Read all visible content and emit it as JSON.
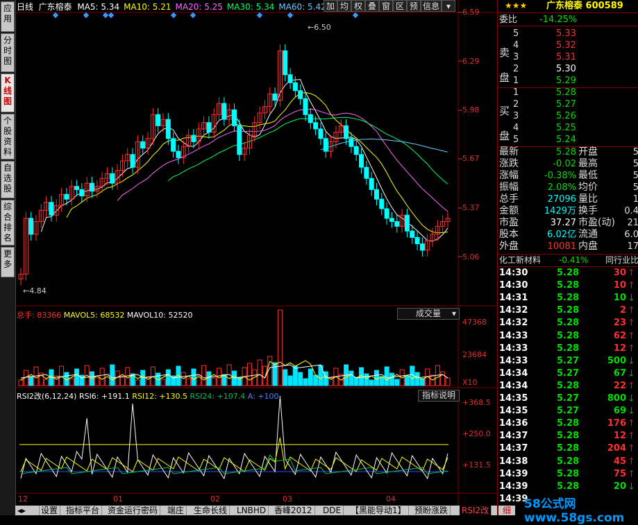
{
  "left_tabs": [
    "应用",
    "分时图",
    "K线图",
    "个股资料",
    "自选股",
    "综合排名",
    "更多"
  ],
  "header": {
    "period": "日线",
    "name": "广东榕泰",
    "ma": [
      {
        "label": "MA5: 5.34",
        "color": "#ffffff"
      },
      {
        "label": "MA10: 5.21",
        "color": "#ffff00"
      },
      {
        "label": "MA20: 5.25",
        "color": "#ff66ff"
      },
      {
        "label": "MA30: 5.34",
        "color": "#00ff66"
      },
      {
        "label": "MA60: 5.42",
        "color": "#66ccff"
      }
    ],
    "buttons": [
      "加",
      "均",
      "权",
      "叠",
      "窗",
      "区",
      "预",
      "信息",
      "▾"
    ]
  },
  "price_axis": [
    "6.59",
    "6.29",
    "5.98",
    "5.67",
    "5.37",
    "5.06"
  ],
  "annotations": {
    "high": "6.50",
    "low": "4.84"
  },
  "volume": {
    "title": "总手: 83366",
    "mavol5": "MAVOL5: 68532",
    "mavol10": "MAVOL10: 52520",
    "dropdown": "成交量",
    "axis": [
      "47368",
      "23684",
      "X10"
    ]
  },
  "rsi": {
    "title": "RSI2改(6,12,24)",
    "rsi6": "RSI6: +191.1",
    "rsi12": "RSI12: +130.5",
    "rsi24": "RSI24: +107.4",
    "a": "A: +100.",
    "explain": "指标说明",
    "axis": [
      "+368.5",
      "+250.0",
      "+131.5"
    ]
  },
  "x_axis": [
    "12",
    "01",
    "02",
    "03",
    "04"
  ],
  "bottom_tabs": [
    "设置",
    "指标平台",
    "资金运行密码",
    "端庄",
    "生命长线",
    "LNBHD",
    "香峰2012",
    "DDE",
    "【黑能导动1】",
    "预盼涨跌",
    "RSI2改"
  ],
  "quote": {
    "title": "广东榕泰 600589",
    "webi_label": "委比",
    "webi_value": "-14.25%",
    "sell_label": "卖盘",
    "buy_label": "买盘",
    "sells": [
      {
        "n": "5",
        "p": "5.33",
        "c": "#ff3030"
      },
      {
        "n": "4",
        "p": "5.32",
        "c": "#ff3030"
      },
      {
        "n": "3",
        "p": "5.31",
        "c": "#ff3030"
      },
      {
        "n": "2",
        "p": "5.30",
        "c": "#ffffff"
      },
      {
        "n": "1",
        "p": "5.29",
        "c": "#00e000"
      }
    ],
    "buys": [
      {
        "n": "1",
        "p": "5.28",
        "c": "#00e000"
      },
      {
        "n": "2",
        "p": "5.27",
        "c": "#00e000"
      },
      {
        "n": "3",
        "p": "5.26",
        "c": "#00e000"
      },
      {
        "n": "4",
        "p": "5.25",
        "c": "#00e000"
      },
      {
        "n": "5",
        "p": "5.24",
        "c": "#00e000"
      }
    ],
    "stats": [
      {
        "l": "最新",
        "v": "5.28",
        "vc": "#00e000",
        "l2": "开盘",
        "v2": "5"
      },
      {
        "l": "涨跌",
        "v": "-0.02",
        "vc": "#00e000",
        "l2": "最高",
        "v2": "5"
      },
      {
        "l": "涨幅",
        "v": "-0.38%",
        "vc": "#00e000",
        "l2": "最低",
        "v2": "5"
      },
      {
        "l": "振幅",
        "v": "2.08%",
        "vc": "#00e000",
        "l2": "均价",
        "v2": "5"
      },
      {
        "l": "总手",
        "v": "27096",
        "vc": "#00ffff",
        "l2": "量比",
        "v2": "1"
      },
      {
        "l": "金额",
        "v": "1429万",
        "vc": "#00ffff",
        "l2": "换手",
        "v2": "0.4"
      },
      {
        "l": "市盈",
        "v": "37.27",
        "vc": "#ffffff",
        "l2": "市盈(动)",
        "v2": "21"
      },
      {
        "l": "股本",
        "v": "6.02亿",
        "vc": "#00ffff",
        "l2": "流通",
        "v2": "6.0"
      },
      {
        "l": "外盘",
        "v": "10081",
        "vc": "#ff3030",
        "l2": "内盘",
        "v2": "17"
      }
    ],
    "sector": "化工新材料",
    "sector_change": "-0.41%",
    "sector_btn": "同行业比",
    "ticks": [
      {
        "t": "14:30",
        "p": "5.28",
        "v": "30",
        "d": "up"
      },
      {
        "t": "14:30",
        "p": "5.28",
        "v": "10",
        "d": "up"
      },
      {
        "t": "14:31",
        "p": "5.28",
        "v": "10",
        "d": "down"
      },
      {
        "t": "14:32",
        "p": "5.28",
        "v": "2",
        "d": "up"
      },
      {
        "t": "14:32",
        "p": "5.28",
        "v": "23",
        "d": "up"
      },
      {
        "t": "14:33",
        "p": "5.28",
        "v": "62",
        "d": "up"
      },
      {
        "t": "14:33",
        "p": "5.28",
        "v": "12",
        "d": "up"
      },
      {
        "t": "14:33",
        "p": "5.27",
        "v": "500",
        "d": "down"
      },
      {
        "t": "14:34",
        "p": "5.27",
        "v": "67",
        "d": "down"
      },
      {
        "t": "14:34",
        "p": "5.28",
        "v": "22",
        "d": "up"
      },
      {
        "t": "14:35",
        "p": "5.27",
        "v": "800",
        "d": "down"
      },
      {
        "t": "14:35",
        "p": "5.27",
        "v": "69",
        "d": "down"
      },
      {
        "t": "14:36",
        "p": "5.28",
        "v": "176",
        "d": "up"
      },
      {
        "t": "14:37",
        "p": "5.28",
        "v": "12",
        "d": "up"
      },
      {
        "t": "14:37",
        "p": "5.28",
        "v": "204",
        "d": "up"
      },
      {
        "t": "14:38",
        "p": "5.28",
        "v": "45",
        "d": "up"
      },
      {
        "t": "14:39",
        "p": "5.28",
        "v": "75",
        "d": "up"
      },
      {
        "t": "14:39",
        "p": "5.28",
        "v": "20",
        "d": "down"
      },
      {
        "t": "14:39",
        "p": "",
        "v": "",
        "d": ""
      }
    ],
    "watermark": "58公式网 www.58gs.com",
    "corner_tab": "细"
  },
  "colors": {
    "up": "#ff3030",
    "down": "#00ffff",
    "axis": "#e03030",
    "grid": "#800000"
  }
}
